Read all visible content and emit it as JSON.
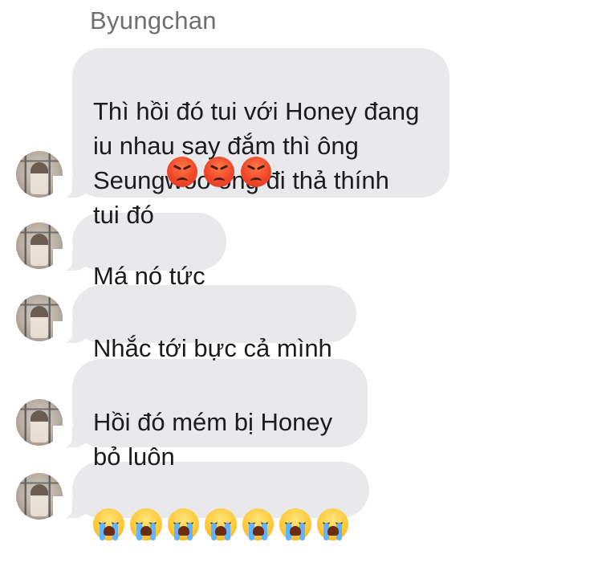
{
  "conversation": {
    "sender_name": "Byungchan",
    "messages": [
      {
        "text": "Thì hồi đó tui với Honey đang\niu nhau say đắm thì ông\nSeungwoo ổng đi thả thính\ntui đó",
        "emojis": [
          "angry-face-emoji",
          "angry-face-emoji",
          "angry-face-emoji"
        ]
      },
      {
        "text": "Má nó tức"
      },
      {
        "text": "Nhắc tới bực cả mình"
      },
      {
        "text": "Hồi đó mém bị Honey\nbỏ luôn"
      },
      {
        "text": "",
        "emojis": [
          "crying-face-emoji",
          "crying-face-emoji",
          "crying-face-emoji",
          "crying-face-emoji",
          "crying-face-emoji",
          "crying-face-emoji",
          "crying-face-emoji"
        ]
      }
    ]
  },
  "colors": {
    "bubble_background": "#e9e9eb",
    "text": "#1c1c1e",
    "sender_name": "#6e6e73",
    "background": "#ffffff"
  }
}
